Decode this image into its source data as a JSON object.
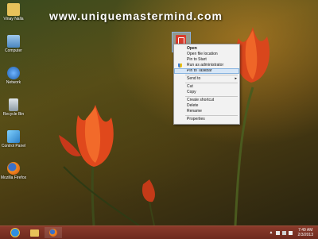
{
  "watermark": "www.uniquemastermind.com",
  "desktop_icons": [
    {
      "label": "Vinay Nalla",
      "icon": "folder-icon"
    },
    {
      "label": "Computer",
      "icon": "computer-icon"
    },
    {
      "label": "Network",
      "icon": "network-icon"
    },
    {
      "label": "Recycle Bin",
      "icon": "recycle-bin-icon"
    },
    {
      "label": "Control Panel",
      "icon": "control-panel-icon"
    },
    {
      "label": "Mozilla Firefox",
      "icon": "firefox-icon"
    }
  ],
  "context_menu": {
    "items": [
      {
        "label": "Open"
      },
      {
        "label": "Open file location"
      },
      {
        "label": "Pin to Start"
      },
      {
        "label": "Run as administrator"
      },
      {
        "label": "Pin to Taskbar"
      },
      {
        "label": "Send to"
      },
      {
        "label": "Cut"
      },
      {
        "label": "Copy"
      },
      {
        "label": "Create shortcut"
      },
      {
        "label": "Delete"
      },
      {
        "label": "Rename"
      },
      {
        "label": "Properties"
      }
    ]
  },
  "taskbar": {
    "pinned": [
      "internet-explorer-icon",
      "file-explorer-icon",
      "firefox-icon"
    ],
    "clock": {
      "time": "7:49 AM",
      "date": "2/3/2013"
    }
  },
  "colors": {
    "taskbar": "#7a3224",
    "menu_highlight": "#d6e6f7",
    "app_icon": "#d83b2b"
  }
}
